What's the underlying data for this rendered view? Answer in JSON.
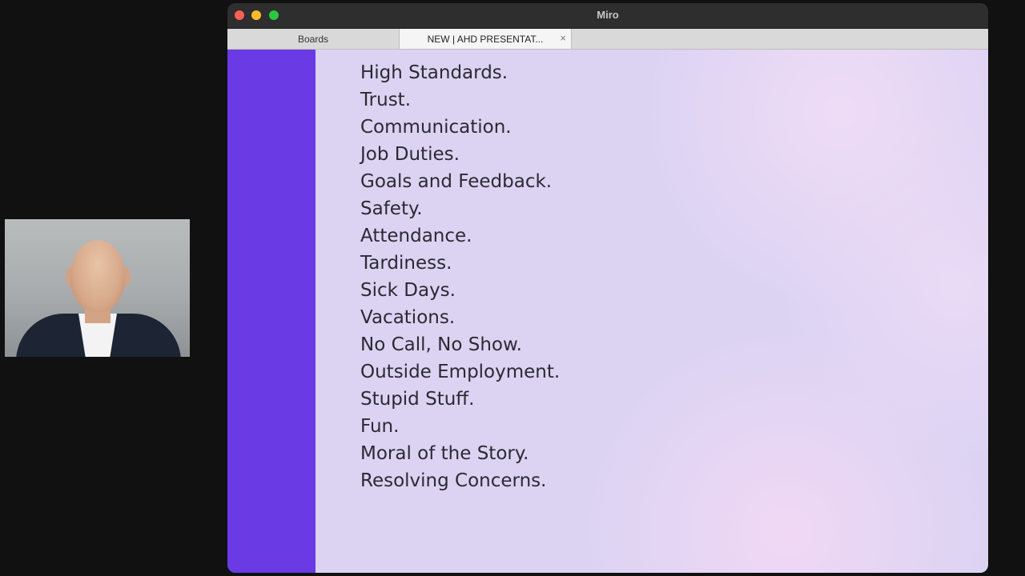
{
  "window": {
    "title": "Miro",
    "tabs": [
      {
        "label": "Boards",
        "active": false
      },
      {
        "label": "NEW | AHD PRESENTAT...",
        "active": true
      }
    ],
    "tab_close_glyph": "×"
  },
  "slide": {
    "items": [
      "High Standards.",
      "Trust.",
      "Communication.",
      "Job Duties.",
      "Goals and Feedback.",
      "Safety.",
      "Attendance.",
      "Tardiness.",
      "Sick Days.",
      "Vacations.",
      "No Call, No Show.",
      "Outside Employment.",
      "Stupid Stuff.",
      "Fun.",
      "Moral of the Story.",
      "Resolving Concerns."
    ]
  },
  "colors": {
    "accent_bar": "#6a3be4",
    "slide_bg": "#dcd3f3",
    "close": "#fe5f57",
    "minimize": "#febc2e",
    "maximize": "#28c840"
  },
  "icons": {
    "close": "close-icon",
    "minimize": "minimize-icon",
    "maximize": "maximize-icon",
    "tab_close": "close-icon"
  }
}
